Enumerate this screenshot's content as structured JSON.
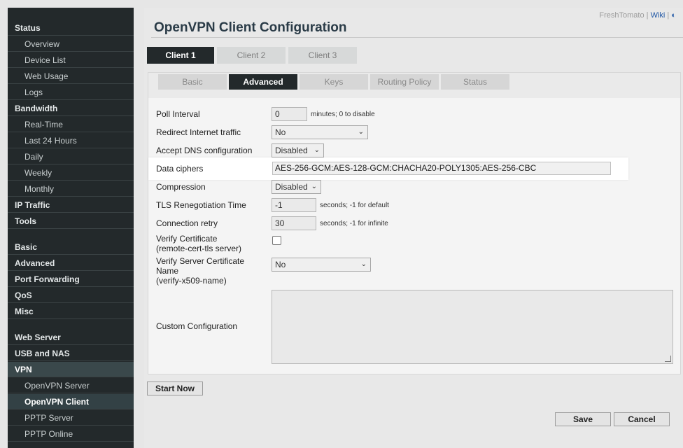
{
  "sidebar": {
    "items": [
      {
        "label": "Status",
        "type": "section"
      },
      {
        "label": "Overview",
        "type": "sub"
      },
      {
        "label": "Device List",
        "type": "sub"
      },
      {
        "label": "Web Usage",
        "type": "sub"
      },
      {
        "label": "Logs",
        "type": "sub"
      },
      {
        "label": "Bandwidth",
        "type": "section"
      },
      {
        "label": "Real-Time",
        "type": "sub"
      },
      {
        "label": "Last 24 Hours",
        "type": "sub"
      },
      {
        "label": "Daily",
        "type": "sub"
      },
      {
        "label": "Weekly",
        "type": "sub"
      },
      {
        "label": "Monthly",
        "type": "sub"
      },
      {
        "label": "IP Traffic",
        "type": "section"
      },
      {
        "label": "Tools",
        "type": "section"
      },
      {
        "label": "Basic",
        "type": "section"
      },
      {
        "label": "Advanced",
        "type": "section"
      },
      {
        "label": "Port Forwarding",
        "type": "section"
      },
      {
        "label": "QoS",
        "type": "section"
      },
      {
        "label": "Misc",
        "type": "section"
      },
      {
        "label": "Web Server",
        "type": "section"
      },
      {
        "label": "USB and NAS",
        "type": "section"
      },
      {
        "label": "VPN",
        "type": "section"
      },
      {
        "label": "OpenVPN Server",
        "type": "sub"
      },
      {
        "label": "OpenVPN Client",
        "type": "sub"
      },
      {
        "label": "PPTP Server",
        "type": "sub"
      },
      {
        "label": "PPTP Online",
        "type": "sub"
      }
    ]
  },
  "header": {
    "brand": "FreshTomato",
    "separator": "|",
    "wiki": "Wiki",
    "theme_icon": "◐",
    "title": "OpenVPN Client Configuration"
  },
  "client_tabs": [
    "Client 1",
    "Client 2",
    "Client 3"
  ],
  "sub_tabs": [
    "Basic",
    "Advanced",
    "Keys",
    "Routing Policy",
    "Status"
  ],
  "form": {
    "poll_interval": {
      "label": "Poll Interval",
      "value": "0",
      "hint": "minutes; 0 to disable"
    },
    "redirect": {
      "label": "Redirect Internet traffic",
      "value": "No"
    },
    "accept_dns": {
      "label": "Accept DNS configuration",
      "value": "Disabled"
    },
    "data_ciphers": {
      "label": "Data ciphers",
      "value": "AES-256-GCM:AES-128-GCM:CHACHA20-POLY1305:AES-256-CBC"
    },
    "compression": {
      "label": "Compression",
      "value": "Disabled"
    },
    "tls_reneg": {
      "label": "TLS Renegotiation Time",
      "value": "-1",
      "hint": "seconds; -1 for default"
    },
    "conn_retry": {
      "label": "Connection retry",
      "value": "30",
      "hint": "seconds; -1 for infinite"
    },
    "verify_cert": {
      "label1": "Verify Certificate",
      "label2": "(remote-cert-tls server)",
      "checked": false
    },
    "verify_server": {
      "label1": "Verify Server Certificate",
      "label2": "Name",
      "label3": "(verify-x509-name)",
      "value": "No"
    },
    "custom_config": {
      "label": "Custom Configuration",
      "value": ""
    }
  },
  "buttons": {
    "start": "Start Now",
    "save": "Save",
    "cancel": "Cancel"
  },
  "colors": {
    "sidebar": "#23292b",
    "active_tab": "#23292b",
    "title": "#2a3b47",
    "link": "#1f57a5"
  }
}
